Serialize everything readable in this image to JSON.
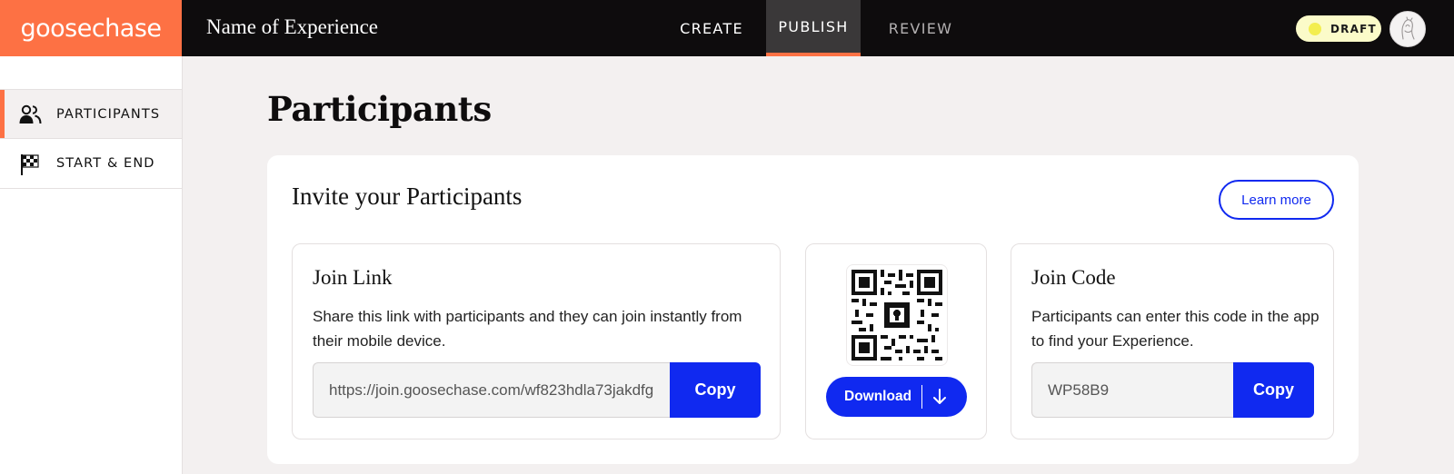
{
  "app": {
    "logo": "goosechase",
    "experience_name": "Name of Experience"
  },
  "nav": {
    "tabs": [
      {
        "label": "CREATE",
        "active": false
      },
      {
        "label": "PUBLISH",
        "active": true
      },
      {
        "label": "REVIEW",
        "active": false
      }
    ],
    "status_badge": "DRAFT",
    "avatar_icon": "user-avatar-icon"
  },
  "sidebar": {
    "items": [
      {
        "label": "PARTICIPANTS",
        "icon": "people-icon",
        "active": true
      },
      {
        "label": "START & END",
        "icon": "checkered-flag-icon",
        "active": false
      }
    ]
  },
  "main": {
    "page_title": "Participants",
    "invite": {
      "title": "Invite your Participants",
      "learn_more_label": "Learn more",
      "join_link": {
        "title": "Join Link",
        "description": "Share this link with participants and they can join instantly from their mobile device.",
        "url": "https://join.goosechase.com/wf823hdla73jakdfg",
        "copy_label": "Copy"
      },
      "qr": {
        "icon": "qr-code-icon",
        "download_label": "Download",
        "download_icon": "arrow-down-icon"
      },
      "join_code": {
        "title": "Join Code",
        "description": "Participants can enter this code in the app to find your Experience.",
        "code": "WP58B9",
        "copy_label": "Copy"
      }
    }
  },
  "colors": {
    "brand_orange": "#fd7144",
    "primary_blue": "#1029f0",
    "topbar_bg": "#0e0c0d",
    "page_bg": "#f3f0f0",
    "draft_badge_bg": "#fbfbc9"
  }
}
